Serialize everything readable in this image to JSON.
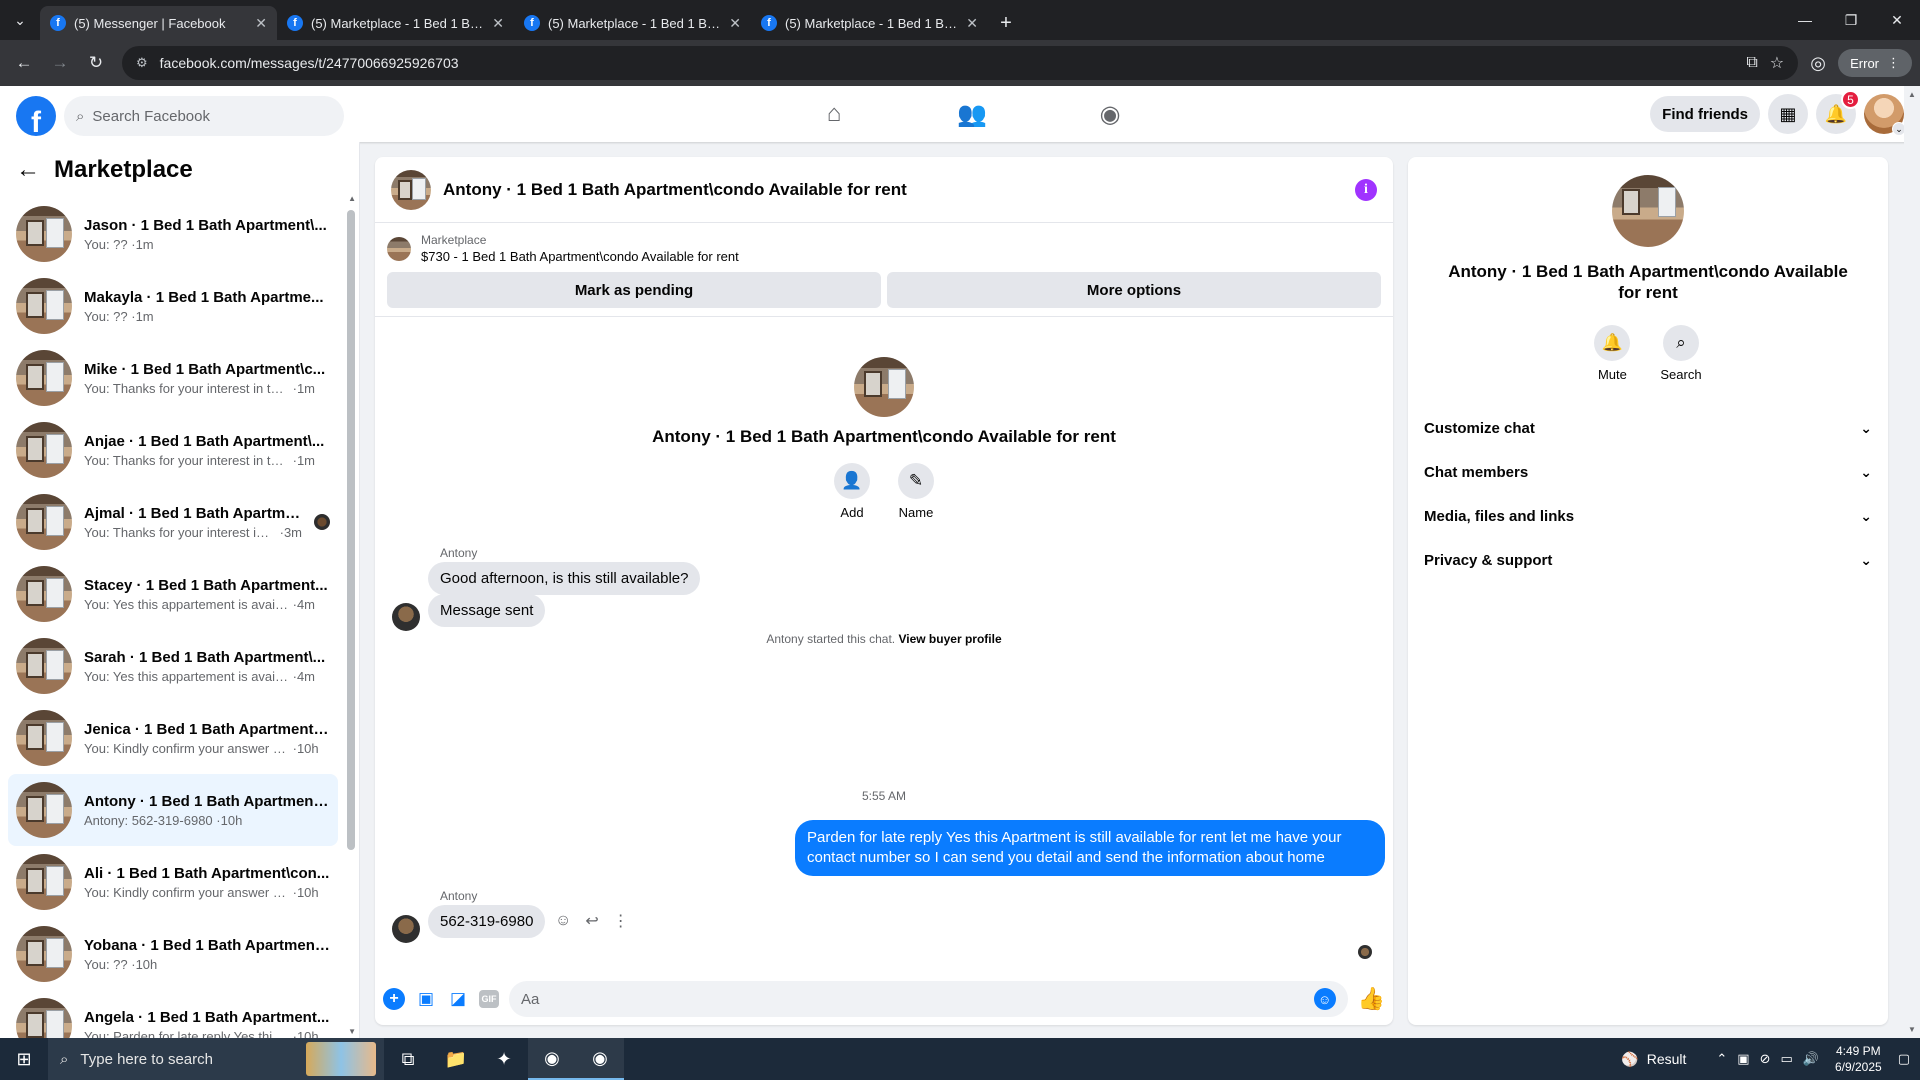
{
  "browser": {
    "tabs": [
      {
        "title": "(5) Messenger | Facebook",
        "active": true
      },
      {
        "title": "(5) Marketplace - 1 Bed 1 Bath",
        "active": false
      },
      {
        "title": "(5) Marketplace - 1 Bed 1 Bath",
        "active": false
      },
      {
        "title": "(5) Marketplace - 1 Bed 1 Bath",
        "active": false
      }
    ],
    "url": "facebook.com/messages/t/24770066925926703",
    "error_label": "Error"
  },
  "fbnav": {
    "search_placeholder": "Search Facebook",
    "find_friends": "Find friends",
    "notifications_count": "5"
  },
  "sidebar": {
    "title": "Marketplace",
    "chats": [
      {
        "name": "Jason · 1 Bed 1 Bath Apartment\\...",
        "preview": "You: ??",
        "time": "1m",
        "active": false,
        "seen": false
      },
      {
        "name": "Makayla · 1 Bed 1 Bath Apartme...",
        "preview": "You: ??",
        "time": "1m",
        "active": false,
        "seen": false
      },
      {
        "name": "Mike · 1 Bed 1 Bath Apartment\\c...",
        "preview": "You: Thanks for your interest in the...",
        "time": "1m",
        "active": false,
        "seen": false
      },
      {
        "name": "Anjae · 1 Bed 1 Bath Apartment\\...",
        "preview": "You: Thanks for your interest in the...",
        "time": "1m",
        "active": false,
        "seen": false
      },
      {
        "name": "Ajmal · 1 Bed 1 Bath Apartmen...",
        "preview": "You: Thanks for your interest in ...",
        "time": "3m",
        "active": false,
        "seen": true
      },
      {
        "name": "Stacey · 1 Bed 1 Bath Apartment...",
        "preview": "You: Yes this appartement is availa...",
        "time": "4m",
        "active": false,
        "seen": false
      },
      {
        "name": "Sarah · 1 Bed 1 Bath Apartment\\...",
        "preview": "You: Yes this appartement is availa...",
        "time": "4m",
        "active": false,
        "seen": false
      },
      {
        "name": "Jenica · 1 Bed 1 Bath Apartment\\...",
        "preview": "You: Kindly confirm your answer a...",
        "time": "10h",
        "active": false,
        "seen": false
      },
      {
        "name": "Antony · 1 Bed 1 Bath Apartment...",
        "preview": "Antony: 562-319-6980",
        "time": "10h",
        "active": true,
        "seen": false
      },
      {
        "name": "Ali · 1 Bed 1 Bath Apartment\\con...",
        "preview": "You: Kindly confirm your answer a...",
        "time": "10h",
        "active": false,
        "seen": false
      },
      {
        "name": "Yobana · 1 Bed 1 Bath Apartment...",
        "preview": "You: ??",
        "time": "10h",
        "active": false,
        "seen": false
      },
      {
        "name": "Angela · 1 Bed 1 Bath Apartment...",
        "preview": "You: Parden for late reply Yes this ...",
        "time": "10h",
        "active": false,
        "seen": false
      }
    ]
  },
  "conversation": {
    "title": "Antony · 1 Bed 1 Bath Apartment\\condo Available for rent",
    "listing_source": "Marketplace",
    "listing_desc": "$730 - 1 Bed 1 Bath Apartment\\condo Available for rent",
    "mark_pending": "Mark as pending",
    "more_options": "More options",
    "intro_name": "Antony · 1 Bed 1 Bath Apartment\\condo Available for rent",
    "add_label": "Add",
    "name_label": "Name",
    "started_text": "Antony started this chat.",
    "view_buyer": "View buyer profile",
    "sender": "Antony",
    "msg1": "Good afternoon, is this still available?",
    "msg2": "Message sent",
    "timestamp": "5:55 AM",
    "my_msg": "Parden for late reply  Yes this Apartment is still available for rent let me have your contact number so I can send you detail and send the information about home",
    "sender2": "Antony",
    "msg3": "562-319-6980",
    "composer_placeholder": "Aa"
  },
  "info_panel": {
    "name": "Antony · 1 Bed 1 Bath Apartment\\condo Available for rent",
    "mute": "Mute",
    "search": "Search",
    "sections": [
      "Customize chat",
      "Chat members",
      "Media, files and links",
      "Privacy & support"
    ]
  },
  "taskbar": {
    "search_placeholder": "Type here to search",
    "result_label": "Result",
    "time": "4:49 PM",
    "date": "6/9/2025"
  },
  "colors": {
    "fb_blue": "#1877f2",
    "messenger_blue": "#0a7cff",
    "info_purple": "#a033ff",
    "active_chat_bg": "#ebf5ff"
  }
}
